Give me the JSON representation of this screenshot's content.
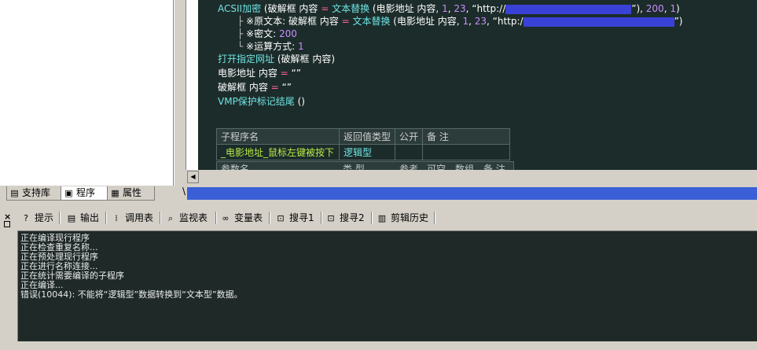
{
  "left_tabs": [
    {
      "label": "支持库",
      "icon": "library-icon"
    },
    {
      "label": "程序",
      "icon": "program-icon"
    },
    {
      "label": "属性",
      "icon": "property-icon"
    }
  ],
  "code": {
    "line1": {
      "fn": "ACSII加密",
      "p1": " (破解框 内容 ",
      "eq": "=",
      "fn2": " 文本替换",
      "p2": " (电影地址 内容, ",
      "n1": "1",
      "c1": ", ",
      "n2": "23",
      "c2": ", ",
      "s1": "“http://",
      "s2": "”), ",
      "n3": "200",
      "c3": ", ",
      "n4": "1",
      "end": ")"
    },
    "line2": {
      "prefix": "※原文本: 破解框 内容 ",
      "eq": "=",
      "fn": " 文本替换",
      "p": " (电影地址 内容, ",
      "n1": "1",
      "c1": ", ",
      "n2": "23",
      "c2": ", ",
      "s1": "“http:/",
      "s2": "”)"
    },
    "line3": {
      "label": "※密文: ",
      "val": "200"
    },
    "line4": {
      "label": "※运算方式: ",
      "val": "1"
    },
    "line5": {
      "fn": "打开指定网址",
      "rest": " (破解框 内容)"
    },
    "line6": {
      "lhs": "电影地址 内容 ",
      "eq": "=",
      "rhs": " “”"
    },
    "line7": {
      "lhs": "破解框 内容 ",
      "eq": "=",
      "rhs": " “”"
    },
    "line8": {
      "fn": "VMP保护标记结尾",
      "rest": " ()"
    }
  },
  "sub_table": {
    "headers": [
      "子程序名",
      "返回值类型",
      "公开",
      "备 注"
    ],
    "row": {
      "name": "_电影地址_鼠标左键被按下",
      "type": "逻辑型",
      "public": "",
      "note": ""
    },
    "param_headers": [
      "参数名",
      "类 型",
      "参考",
      "可空",
      "数组",
      "备 注"
    ]
  },
  "slash_char": "\\",
  "bottom_tabs": [
    {
      "label": "提示",
      "icon": "hint-icon"
    },
    {
      "label": "输出",
      "icon": "output-icon"
    },
    {
      "label": "调用表",
      "icon": "call-table-icon"
    },
    {
      "label": "监视表",
      "icon": "watch-icon"
    },
    {
      "label": "变量表",
      "icon": "variable-icon"
    },
    {
      "label": "搜寻1",
      "icon": "search1-icon"
    },
    {
      "label": "搜寻2",
      "icon": "search2-icon"
    },
    {
      "label": "剪辑历史",
      "icon": "clip-history-icon"
    }
  ],
  "side_close": "×",
  "output_lines": [
    "正在编译现行程序",
    "正在检查重复名称...",
    "正在预处理现行程序",
    "正在进行名称连接...",
    "正在统计需要编译的子程序",
    "正在编译...",
    "错误(10044): 不能将“逻辑型”数据转换到“文本型”数据。"
  ],
  "colors": {
    "editor_bg": "#1c2c2a",
    "function": "#6fe3e3",
    "operator": "#ff5f9a",
    "number": "#c98cff",
    "highlight": "#3a41d6"
  }
}
